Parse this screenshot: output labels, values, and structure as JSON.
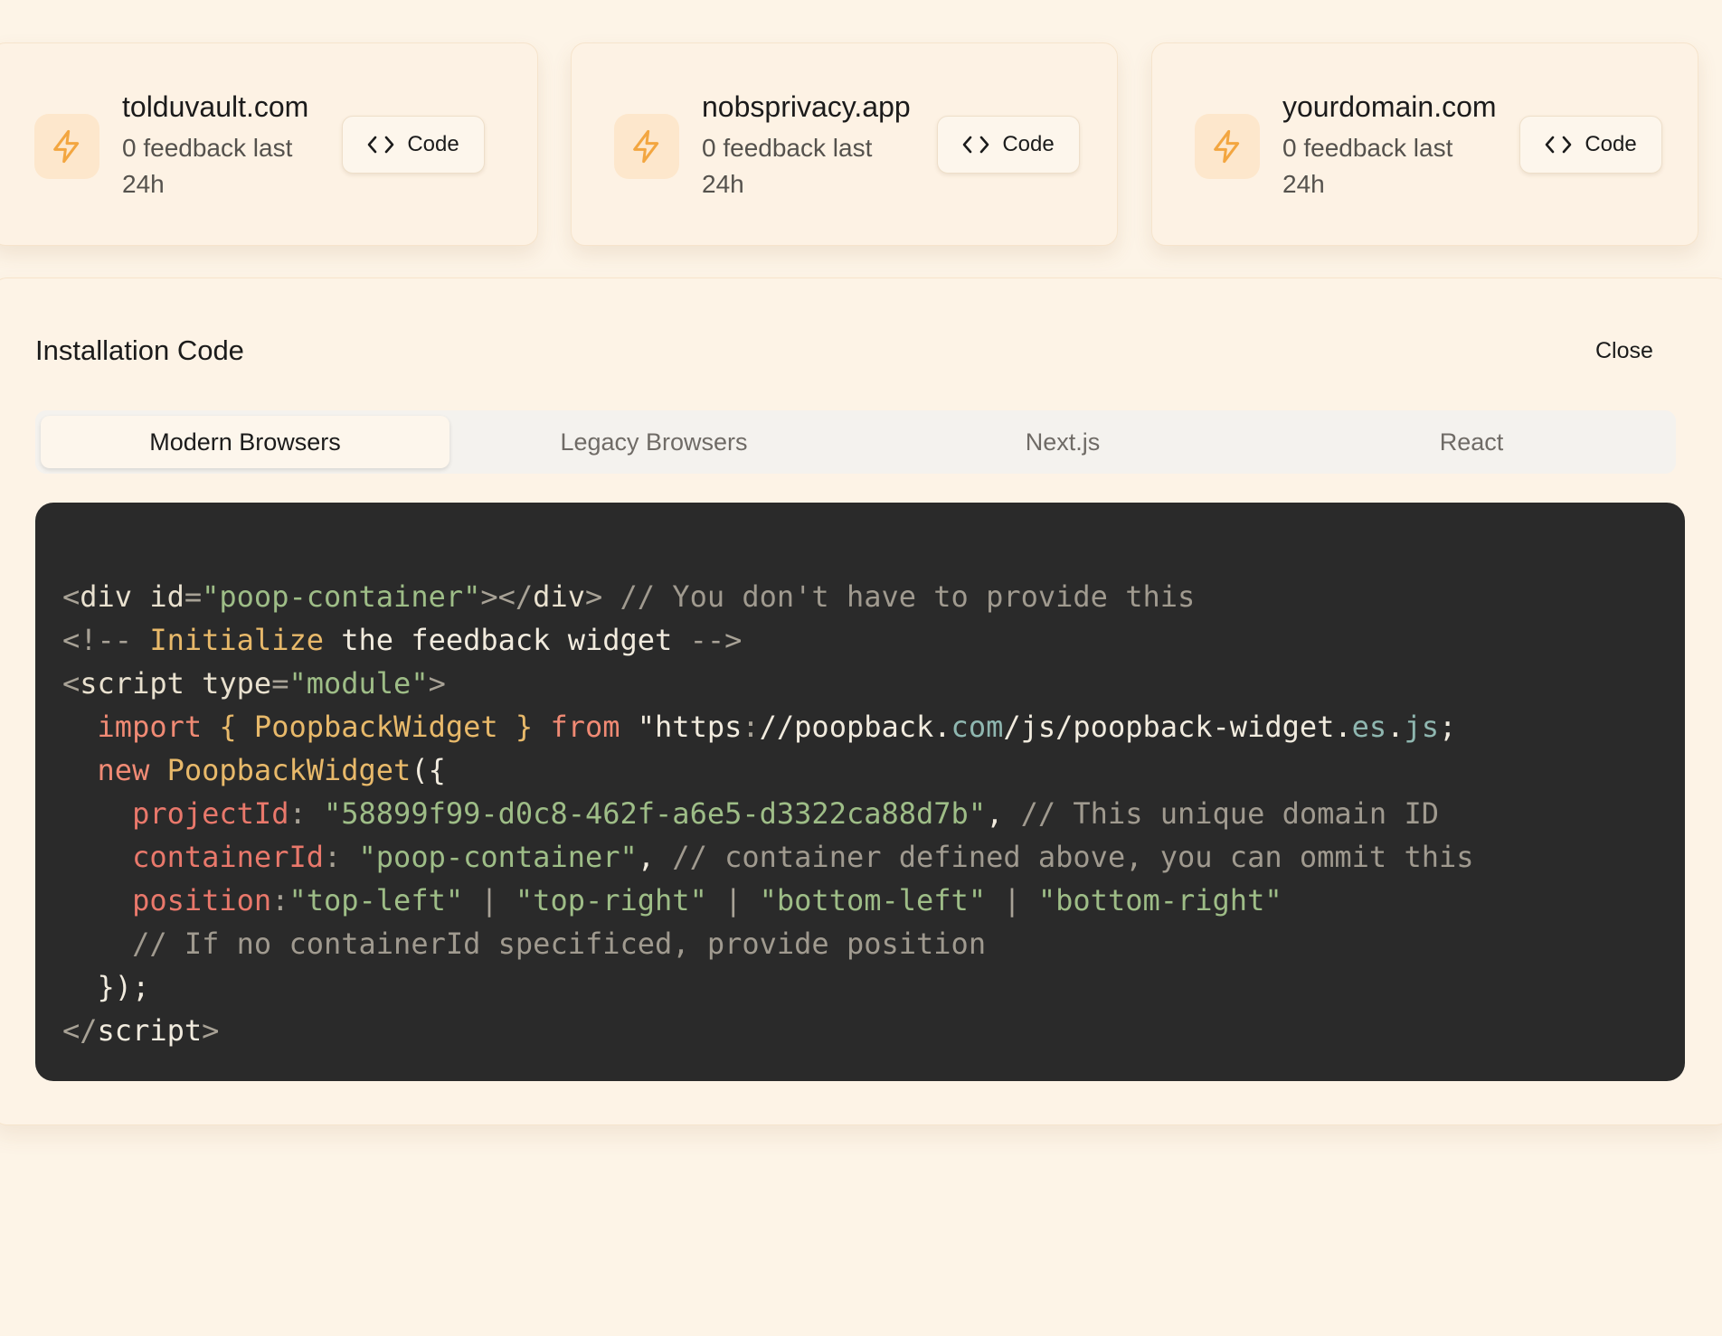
{
  "projects": [
    {
      "domain": "tolduvault.com",
      "feedback": "0 feedback last 24h",
      "code_label": "Code"
    },
    {
      "domain": "nobsprivacy.app",
      "feedback": "0 feedback last 24h",
      "code_label": "Code"
    },
    {
      "domain": "yourdomain.com",
      "feedback": "0 feedback last 24h",
      "code_label": "Code"
    }
  ],
  "panel": {
    "title": "Installation Code",
    "close_label": "Close",
    "tabs": [
      {
        "label": "Modern Browsers",
        "active": true
      },
      {
        "label": "Legacy Browsers",
        "active": false
      },
      {
        "label": "Next.js",
        "active": false
      },
      {
        "label": "React",
        "active": false
      }
    ],
    "code_lines": [
      [
        [
          "t-punc",
          "<"
        ],
        [
          "t-tag",
          "div "
        ],
        [
          "t-attr",
          "id"
        ],
        [
          "t-punc",
          "="
        ],
        [
          "t-str",
          "\"poop-container\""
        ],
        [
          "t-punc",
          "></"
        ],
        [
          "t-tag",
          "div"
        ],
        [
          "t-punc",
          "> "
        ],
        [
          "t-cmt",
          "// You don't have to provide this"
        ]
      ],
      [
        [
          "t-punc",
          "<!-- "
        ],
        [
          "t-fn",
          "Initialize "
        ],
        [
          "t-plain",
          "the feedback widget "
        ],
        [
          "t-punc",
          "-->"
        ]
      ],
      [
        [
          "t-punc",
          "<"
        ],
        [
          "t-tag",
          "script "
        ],
        [
          "t-attr",
          "type"
        ],
        [
          "t-punc",
          "="
        ],
        [
          "t-str",
          "\"module\""
        ],
        [
          "t-punc",
          ">"
        ]
      ],
      [
        [
          "t-plain",
          "  "
        ],
        [
          "t-kw",
          "import "
        ],
        [
          "t-fn",
          "{ PoopbackWidget } "
        ],
        [
          "t-kw",
          "from "
        ],
        [
          "t-plain",
          "\"https"
        ],
        [
          "t-punc",
          ":"
        ],
        [
          "t-plain",
          "//poopback."
        ],
        [
          "t-teal",
          "com"
        ],
        [
          "t-plain",
          "/js/poopback-widget."
        ],
        [
          "t-teal",
          "es"
        ],
        [
          "t-plain",
          "."
        ],
        [
          "t-teal",
          "js"
        ],
        [
          "t-plain",
          ";"
        ]
      ],
      [
        [
          "t-plain",
          "  "
        ],
        [
          "t-kw",
          "new "
        ],
        [
          "t-fn",
          "PoopbackWidget"
        ],
        [
          "t-plain",
          "({"
        ]
      ],
      [
        [
          "t-plain",
          "    "
        ],
        [
          "t-prop",
          "projectId"
        ],
        [
          "t-punc",
          ": "
        ],
        [
          "t-str",
          "\"58899f99-d0c8-462f-a6e5-d3322ca88d7b\""
        ],
        [
          "t-plain",
          ", "
        ],
        [
          "t-cmt",
          "// This unique domain ID"
        ]
      ],
      [
        [
          "t-plain",
          "    "
        ],
        [
          "t-prop",
          "containerId"
        ],
        [
          "t-punc",
          ": "
        ],
        [
          "t-str",
          "\"poop-container\""
        ],
        [
          "t-plain",
          ", "
        ],
        [
          "t-cmt",
          "// container defined above, you can ommit this"
        ]
      ],
      [
        [
          "t-plain",
          "    "
        ],
        [
          "t-prop",
          "position"
        ],
        [
          "t-punc",
          ":"
        ],
        [
          "t-str",
          "\"top-left\""
        ],
        [
          "t-punc",
          " | "
        ],
        [
          "t-str",
          "\"top-right\""
        ],
        [
          "t-punc",
          " | "
        ],
        [
          "t-str",
          "\"bottom-left\""
        ],
        [
          "t-punc",
          " | "
        ],
        [
          "t-str",
          "\"bottom-right\""
        ]
      ],
      [
        [
          "t-plain",
          "    "
        ],
        [
          "t-cmt",
          "// If no containerId specificed, provide position"
        ]
      ],
      [
        [
          "t-plain",
          "  });"
        ]
      ],
      [
        [
          "t-punc",
          "</"
        ],
        [
          "t-plain",
          "script"
        ],
        [
          "t-punc",
          ">"
        ]
      ]
    ]
  },
  "colors": {
    "accent": "#f3a640",
    "icon_bg": "#fde7cc",
    "code_bg": "#2a2a2a"
  },
  "icons": {
    "project": "lightning-bolt-icon",
    "code": "code-brackets-icon"
  }
}
